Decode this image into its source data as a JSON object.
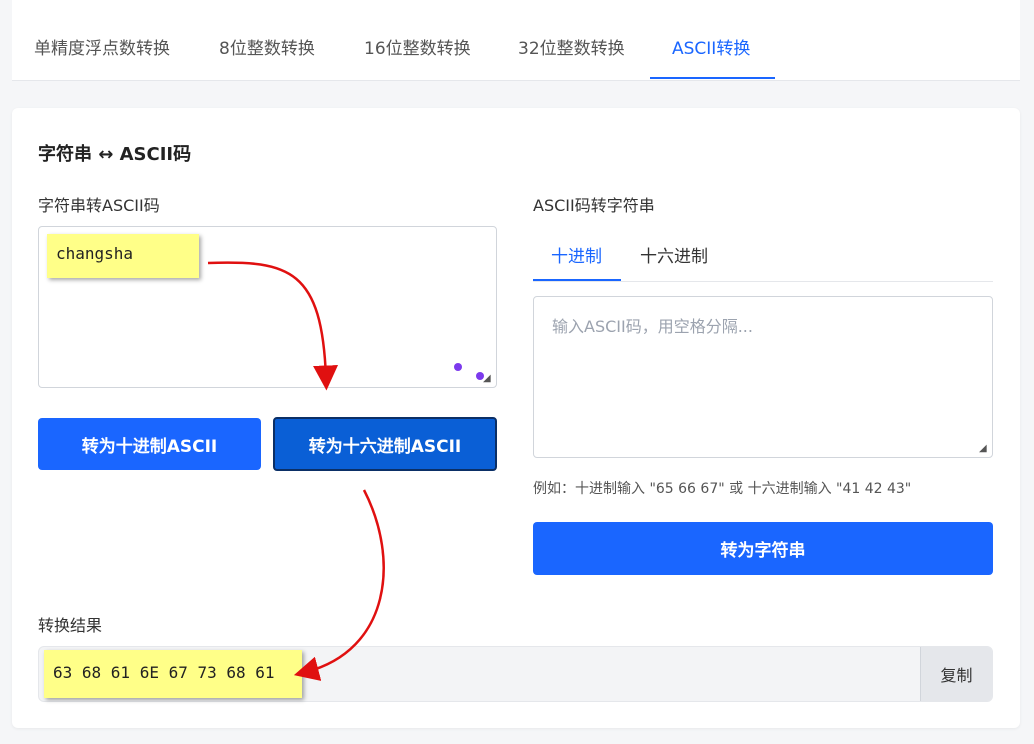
{
  "top_tabs": [
    {
      "label": "单精度浮点数转换",
      "active": false
    },
    {
      "label": "8位整数转换",
      "active": false
    },
    {
      "label": "16位整数转换",
      "active": false
    },
    {
      "label": "32位整数转换",
      "active": false
    },
    {
      "label": "ASCII转换",
      "active": true
    }
  ],
  "section": {
    "title": "字符串 ↔ ASCII码"
  },
  "left_panel": {
    "label": "字符串转ASCII码",
    "input_value": "changsha",
    "decimal_button": "转为十进制ASCII",
    "hex_button": "转为十六进制ASCII"
  },
  "right_panel": {
    "label": "ASCII码转字符串",
    "tabs": [
      {
        "label": "十进制",
        "active": true
      },
      {
        "label": "十六进制",
        "active": false
      }
    ],
    "placeholder": "输入ASCII码，用空格分隔...",
    "hint": "例如：十进制输入 \"65 66 67\" 或 十六进制输入 \"41 42 43\"",
    "convert_button": "转为字符串"
  },
  "result": {
    "label": "转换结果",
    "value": "63 68 61 6E 67 73 68 61",
    "copy_button": "复制"
  },
  "colors": {
    "accent": "#1a66ff",
    "highlight": "#ffff88",
    "arrow": "#e01010"
  }
}
